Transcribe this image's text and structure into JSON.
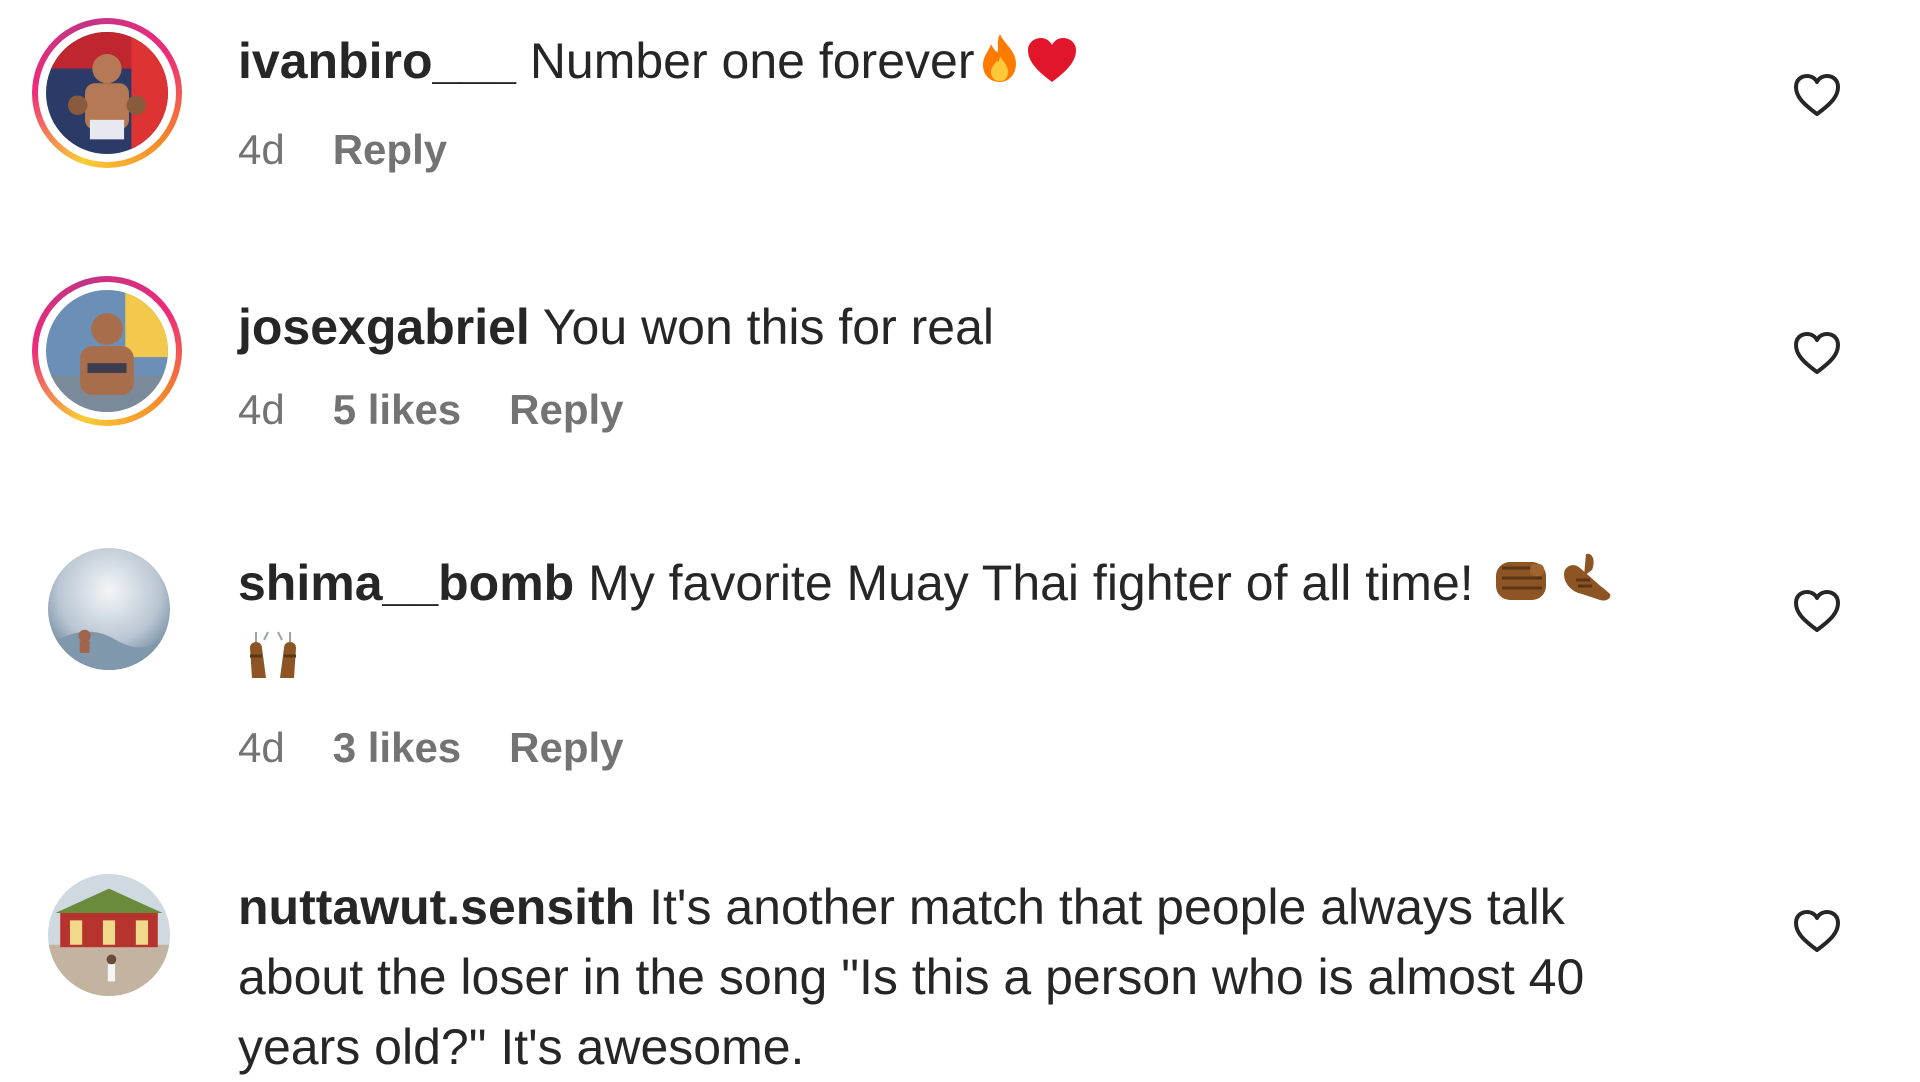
{
  "comments": [
    {
      "username": "ivanbiro___",
      "text": "Number one forever",
      "emoji": [
        "fire-emoji",
        "red-heart-emoji"
      ],
      "time": "4d",
      "likes": "",
      "reply_label": "Reply",
      "story_ring": true
    },
    {
      "username": "josexgabriel",
      "text": "You won this for real",
      "emoji": [],
      "time": "4d",
      "likes": "5 likes",
      "reply_label": "Reply",
      "story_ring": true
    },
    {
      "username": "shima__bomb",
      "text": "My favorite Muay Thai fighter of all time!",
      "emoji": [
        "oncoming-fist-emoji",
        "call-me-hand-emoji",
        "raising-hands-emoji"
      ],
      "time": "4d",
      "likes": "3 likes",
      "reply_label": "Reply",
      "story_ring": false
    },
    {
      "username": "nuttawut.sensith",
      "text": "It's another match that people always talk about the loser in the song \"Is this a person who is almost 40 years old?\" It's awesome.",
      "emoji": [],
      "time": "",
      "likes": "",
      "reply_label": "",
      "story_ring": false
    }
  ],
  "colors": {
    "text": "#262626",
    "meta": "#737373",
    "fire": "#ff6a00",
    "heart_red": "#e2162b",
    "skin": "#8d5524"
  }
}
